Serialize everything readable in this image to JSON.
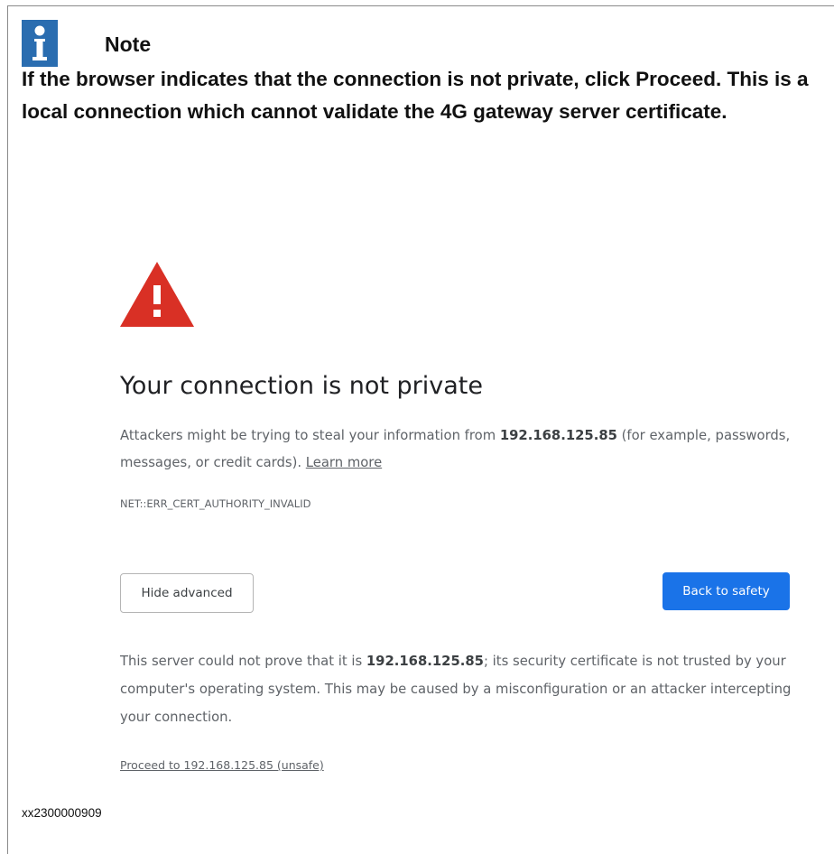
{
  "note": {
    "title": "Note",
    "text_before": "If the browser indicates that the connection is not private, click ",
    "text_bold": "Proceed",
    "text_after": ". This is a local connection which cannot validate the 4G gateway server certificate."
  },
  "interstitial": {
    "heading": "Your connection is not private",
    "body_before": "Attackers might be trying to steal your information from ",
    "body_host": "192.168.125.85",
    "body_after": " (for example, passwords, messages, or credit cards). ",
    "learn_more_label": "Learn more",
    "error_code": "NET::ERR_CERT_AUTHORITY_INVALID",
    "hide_advanced_label": "Hide advanced",
    "back_to_safety_label": "Back to safety",
    "details_before": "This server could not prove that it is ",
    "details_host": "192.168.125.85",
    "details_after": "; its security certificate is not trusted by your computer's operating system. This may be caused by a misconfiguration or an attacker intercepting your connection.",
    "proceed_link_label": "Proceed to 192.168.125.85 (unsafe)"
  },
  "figure_id": "xx2300000909",
  "colors": {
    "note_icon_bg": "#2a6db0",
    "warning_red": "#d93025",
    "primary_button": "#1a73e8"
  },
  "icons": {
    "note": "info-icon",
    "warning": "warning-triangle-icon"
  }
}
